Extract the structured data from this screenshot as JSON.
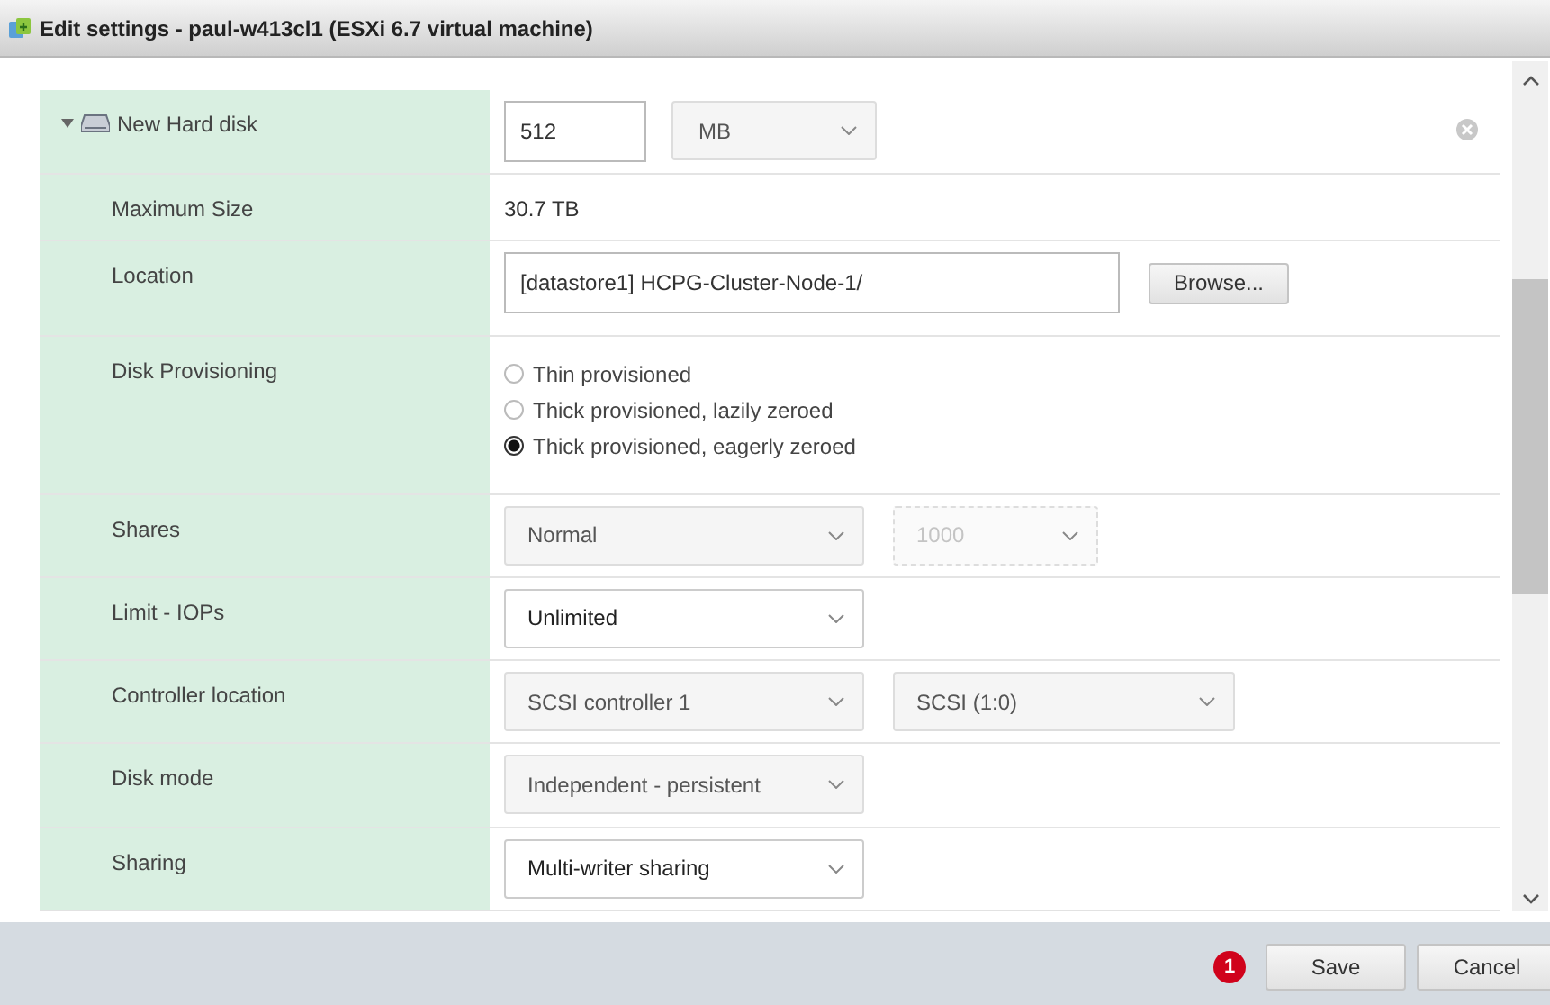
{
  "window": {
    "title": "Edit settings - paul-w413cl1 (ESXi 6.7 virtual machine)"
  },
  "device": {
    "label": "New Hard disk",
    "expanded": true,
    "size": "512",
    "unit": "MB"
  },
  "rows": [
    {
      "kind": "text",
      "label": "Maximum Size",
      "value": "30.7 TB"
    },
    {
      "kind": "location",
      "label": "Location",
      "value": "[datastore1] HCPG-Cluster-Node-1/",
      "button": "Browse..."
    },
    {
      "kind": "radio",
      "label": "Disk Provisioning",
      "options": [
        {
          "label": "Thin provisioned",
          "selected": false
        },
        {
          "label": "Thick provisioned, lazily zeroed",
          "selected": false
        },
        {
          "label": "Thick provisioned, eagerly zeroed",
          "selected": true
        }
      ]
    },
    {
      "kind": "selects",
      "label": "Shares",
      "selects": [
        {
          "value": "Normal",
          "disabled": false,
          "active": false
        },
        {
          "value": "1000",
          "disabled": true,
          "active": false
        }
      ]
    },
    {
      "kind": "selects",
      "label": "Limit - IOPs",
      "selects": [
        {
          "value": "Unlimited",
          "disabled": false,
          "active": true
        }
      ]
    },
    {
      "kind": "selects",
      "label": "Controller location",
      "selects": [
        {
          "value": "SCSI controller 1",
          "disabled": false,
          "active": false
        },
        {
          "value": "SCSI (1:0)",
          "disabled": false,
          "active": false
        }
      ]
    },
    {
      "kind": "selects",
      "label": "Disk mode",
      "selects": [
        {
          "value": "Independent - persistent",
          "disabled": false,
          "active": false
        }
      ]
    },
    {
      "kind": "selects",
      "label": "Sharing",
      "selects": [
        {
          "value": "Multi-writer sharing",
          "disabled": false,
          "active": true
        }
      ]
    }
  ],
  "footer": {
    "error_count": "1",
    "buttons": [
      "Save",
      "Cancel"
    ]
  }
}
